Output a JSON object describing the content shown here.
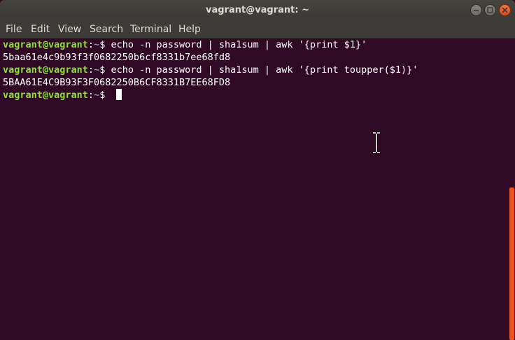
{
  "window": {
    "title": "vagrant@vagrant: ~"
  },
  "menu": {
    "items": [
      {
        "label": "File"
      },
      {
        "label": "Edit"
      },
      {
        "label": "View"
      },
      {
        "label": "Search"
      },
      {
        "label": "Terminal"
      },
      {
        "label": "Help"
      }
    ]
  },
  "terminal": {
    "prompt_user": "vagrant@vagrant",
    "prompt_sep": ":",
    "prompt_path": "~",
    "prompt_symbol": "$ ",
    "lines": [
      {
        "type": "command",
        "text": "echo -n password | sha1sum | awk '{print $1}'"
      },
      {
        "type": "output",
        "text": "5baa61e4c9b93f3f0682250b6cf8331b7ee68fd8"
      },
      {
        "type": "command",
        "text": "echo -n password | sha1sum | awk '{print toupper($1)}'"
      },
      {
        "type": "output",
        "text": "5BAA61E4C9B93F3F0682250B6CF8331B7EE68FD8"
      },
      {
        "type": "prompt",
        "text": ""
      }
    ]
  },
  "colors": {
    "background": "#300a24",
    "prompt_user": "#8ae234",
    "prompt_path": "#729fcf",
    "text": "#ffffff",
    "scrollbar": "#e95420"
  },
  "icons": {
    "minimize": "minimize-icon",
    "maximize": "maximize-icon",
    "close": "close-icon",
    "pointer": "text-cursor-ibeam-icon"
  }
}
